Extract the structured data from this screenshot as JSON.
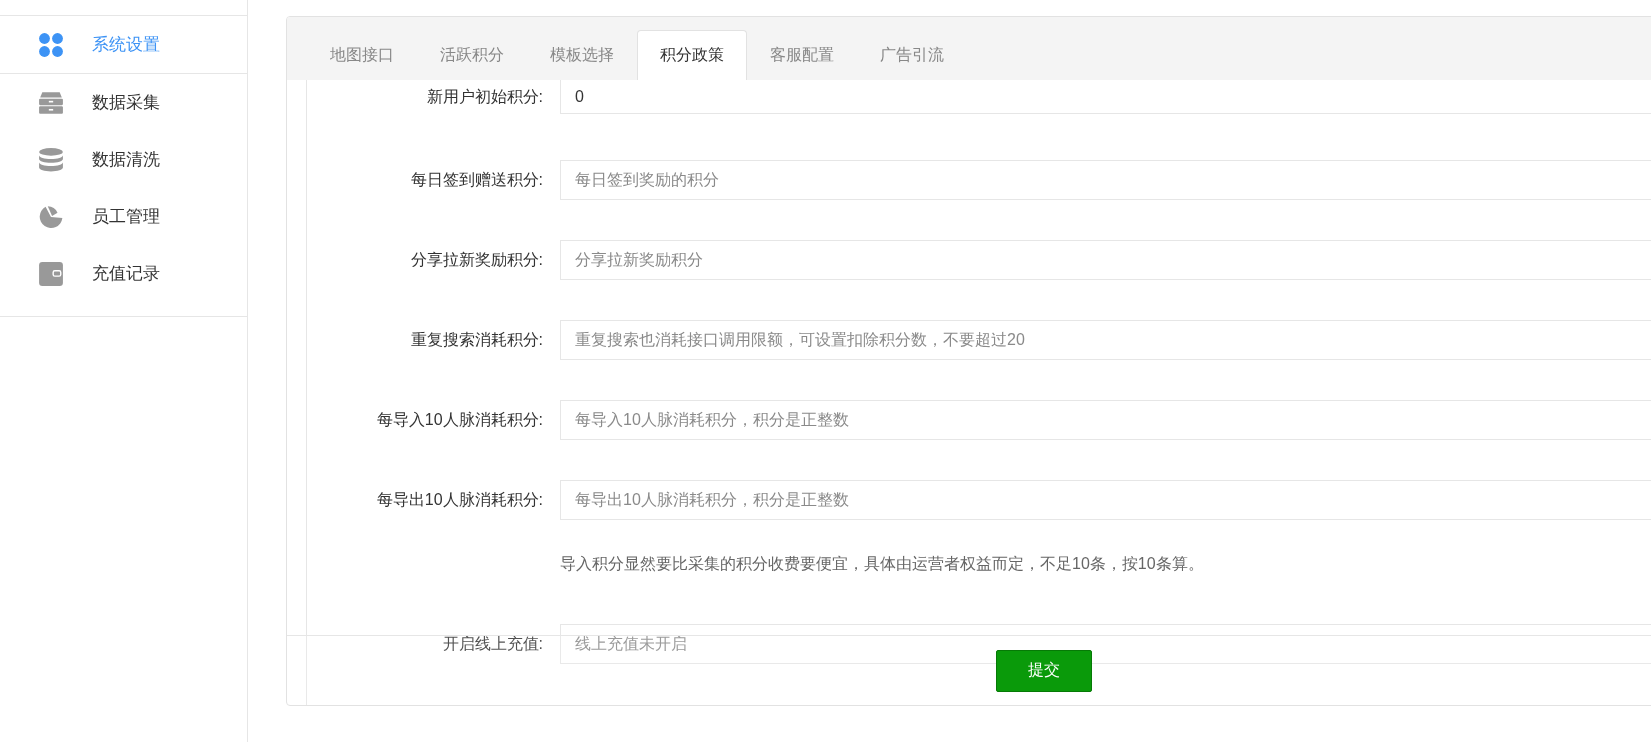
{
  "sidebar": {
    "items": [
      {
        "label": "系统设置",
        "selected": true
      },
      {
        "label": "数据采集",
        "selected": false
      },
      {
        "label": "数据清洗",
        "selected": false
      },
      {
        "label": "员工管理",
        "selected": false
      },
      {
        "label": "充值记录",
        "selected": false
      }
    ]
  },
  "tabs": [
    {
      "label": "地图接口",
      "selected": false
    },
    {
      "label": "活跃积分",
      "selected": false
    },
    {
      "label": "模板选择",
      "selected": false
    },
    {
      "label": "积分政策",
      "selected": true
    },
    {
      "label": "客服配置",
      "selected": false
    },
    {
      "label": "广告引流",
      "selected": false
    }
  ],
  "form": {
    "rows": [
      {
        "kind": "field",
        "label": "新用户初始积分:",
        "value": "0"
      },
      {
        "kind": "field",
        "label": "每日签到赠送积分:",
        "placeholder": "每日签到奖励的积分"
      },
      {
        "kind": "field",
        "label": "分享拉新奖励积分:",
        "placeholder": "分享拉新奖励积分"
      },
      {
        "kind": "field",
        "label": "重复搜索消耗积分:",
        "placeholder": "重复搜索也消耗接口调用限额，可设置扣除积分数，不要超过20"
      },
      {
        "kind": "field",
        "label": "每导入10人脉消耗积分:",
        "placeholder": "每导入10人脉消耗积分，积分是正整数"
      },
      {
        "kind": "field",
        "label": "每导出10人脉消耗积分:",
        "placeholder": "每导出10人脉消耗积分，积分是正整数"
      },
      {
        "kind": "note",
        "text": "导入积分显然要比采集的积分收费要便宜，具体由运营者权益而定，不足10条，按10条算。"
      },
      {
        "kind": "field",
        "label": "开启线上充值:",
        "placeholder": "线上充值未开启"
      }
    ]
  },
  "submit_button": "提交"
}
